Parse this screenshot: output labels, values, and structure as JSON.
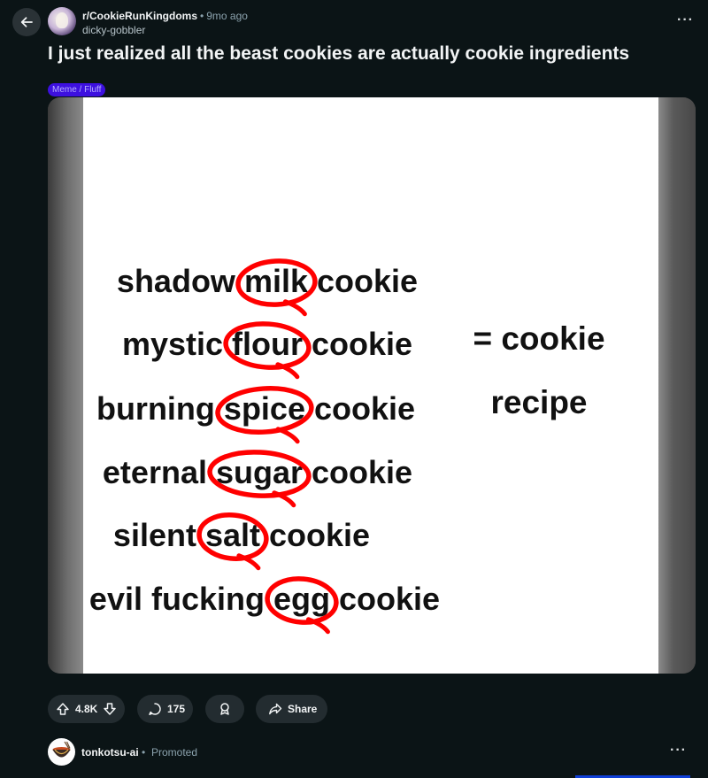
{
  "header": {
    "subreddit": "r/CookieRunKingdoms",
    "separator": "•",
    "time": "9mo ago",
    "author": "dicky-gobbler",
    "more": "···"
  },
  "post": {
    "title": "I just realized all the beast cookies are actually cookie ingredients",
    "flair": "Meme / Fluff",
    "flair_color": "#3d10e0"
  },
  "meme": {
    "rows": [
      {
        "prefix": "shadow",
        "ingredient": "milk",
        "suffix": "cookie"
      },
      {
        "prefix": "mystic",
        "ingredient": "flour",
        "suffix": "cookie"
      },
      {
        "prefix": "burning",
        "ingredient": "spice",
        "suffix": "cookie"
      },
      {
        "prefix": "eternal",
        "ingredient": "sugar",
        "suffix": "cookie"
      },
      {
        "prefix": "silent",
        "ingredient": "salt",
        "suffix": "cookie"
      },
      {
        "prefix": "evil fucking",
        "ingredient": "egg",
        "suffix": "cookie"
      }
    ],
    "result_line1": "= cookie",
    "result_line2": "recipe",
    "circle_color": "#ff0000"
  },
  "actions": {
    "votes": "4.8K",
    "comments": "175",
    "share": "Share"
  },
  "promoted": {
    "name": "tonkotsu-ai",
    "separator": "•",
    "label": "Promoted",
    "more": "···"
  },
  "icons": {
    "back": "arrow-left-icon",
    "upvote": "upvote-icon",
    "downvote": "downvote-icon",
    "comment": "comment-icon",
    "award": "award-icon",
    "share": "share-icon"
  }
}
